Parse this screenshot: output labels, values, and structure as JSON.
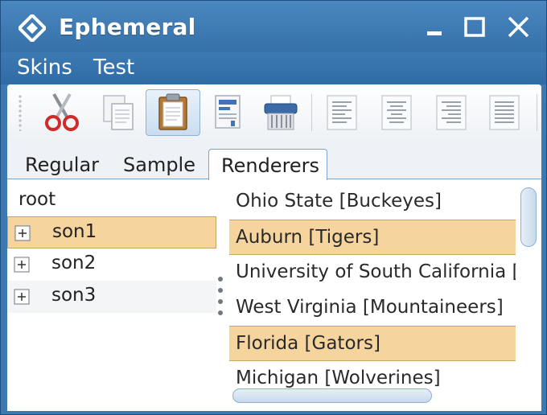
{
  "window": {
    "title": "Ephemeral",
    "icon": "diamond-logo-icon",
    "buttons": [
      "minimize-icon",
      "maximize-icon",
      "close-icon"
    ]
  },
  "menu": {
    "skins": "Skins",
    "test": "Test"
  },
  "toolbar": {
    "buttons": [
      {
        "icon": "scissors-cut-icon",
        "selected": false
      },
      {
        "icon": "copy-icon",
        "selected": false
      },
      {
        "icon": "clipboard-paste-icon",
        "selected": true
      },
      {
        "icon": "document-icon",
        "selected": false
      },
      {
        "icon": "shredder-icon",
        "selected": false
      },
      {
        "icon": "align-left-icon",
        "selected": false
      },
      {
        "icon": "align-center-icon",
        "selected": false
      },
      {
        "icon": "align-right-icon",
        "selected": false
      },
      {
        "icon": "align-justify-icon",
        "selected": false
      }
    ]
  },
  "tabs": {
    "regular": "Regular",
    "sample": "Sample",
    "renderers": "Renderers",
    "active": "Renderers"
  },
  "tree": {
    "root": "root",
    "nodes": [
      {
        "label": "son1",
        "selected": true
      },
      {
        "label": "son2",
        "selected": false
      },
      {
        "label": "son3",
        "selected": false
      }
    ]
  },
  "list": {
    "items": [
      {
        "text": "Ohio State [Buckeyes]",
        "selected": false
      },
      {
        "text": "Auburn [Tigers]",
        "selected": true
      },
      {
        "text": "University of South California [Trojans]",
        "selected": false
      },
      {
        "text": "West Virginia [Mountaineers]",
        "selected": false
      },
      {
        "text": "Florida [Gators]",
        "selected": true
      },
      {
        "text": "Michigan [Wolverines]",
        "selected": false
      }
    ]
  },
  "colors": {
    "titlebar": "#3d79b1",
    "selection": "#f5d49e",
    "selection_border": "#c9a566",
    "text": "#222222"
  }
}
